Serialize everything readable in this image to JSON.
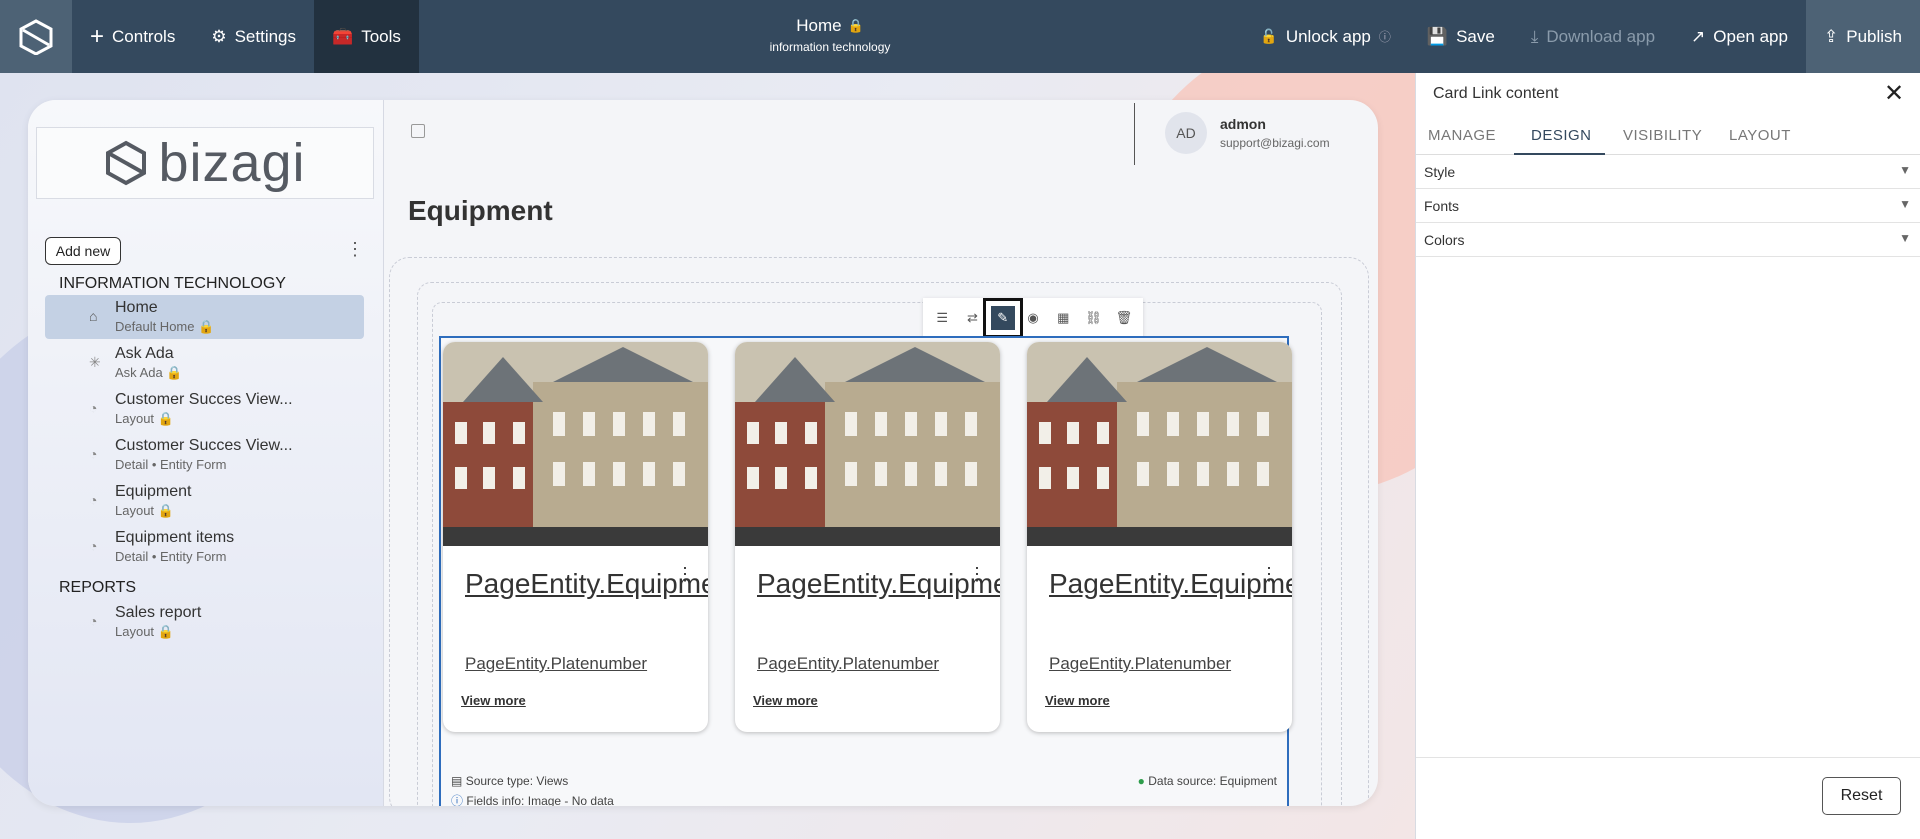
{
  "topbar": {
    "controls": "Controls",
    "settings": "Settings",
    "tools": "Tools",
    "title": "Home",
    "subtitle": "information technology",
    "unlock": "Unlock app",
    "save": "Save",
    "download": "Download app",
    "open": "Open app",
    "publish": "Publish"
  },
  "sidebar": {
    "brand": "bizagi",
    "add_new": "Add new",
    "section1": "INFORMATION TECHNOLOGY",
    "section2": "REPORTS",
    "items": [
      {
        "label": "Home",
        "sub": "Default Home"
      },
      {
        "label": "Ask Ada",
        "sub": "Ask Ada"
      },
      {
        "label": "Customer Succes View...",
        "sub": "Layout"
      },
      {
        "label": "Customer Succes View...",
        "sub": "Detail • Entity Form"
      },
      {
        "label": "Equipment",
        "sub": "Layout"
      },
      {
        "label": "Equipment items",
        "sub": "Detail • Entity Form"
      },
      {
        "label": "Sales report",
        "sub": "Layout"
      }
    ]
  },
  "user": {
    "initials": "AD",
    "name": "admon",
    "email": "support@bizagi.com"
  },
  "main": {
    "title": "Equipment"
  },
  "cards": [
    {
      "title": "PageEntity.Equipmentname",
      "sub": "PageEntity.Platenumber",
      "more": "View more"
    },
    {
      "title": "PageEntity.Equipmentname",
      "sub": "PageEntity.Platenumber",
      "more": "View more"
    },
    {
      "title": "PageEntity.Equipmentname",
      "sub": "PageEntity.Platenumber",
      "more": "View more"
    }
  ],
  "footer": {
    "source_label": "Source type:",
    "source_value": "Views",
    "fields_label": "Fields info:",
    "fields_value": "Image - No data",
    "ds_label": "Data source:",
    "ds_value": "Equipment"
  },
  "panel": {
    "title": "Card Link content",
    "tabs": [
      "MANAGE",
      "DESIGN",
      "VISIBILITY",
      "LAYOUT"
    ],
    "sections": [
      "Style",
      "Fonts",
      "Colors"
    ],
    "reset": "Reset"
  },
  "colors": {
    "topbar": "#34495e",
    "selection": "#2e6dbd",
    "selected_nav": "#c4d1e4"
  }
}
